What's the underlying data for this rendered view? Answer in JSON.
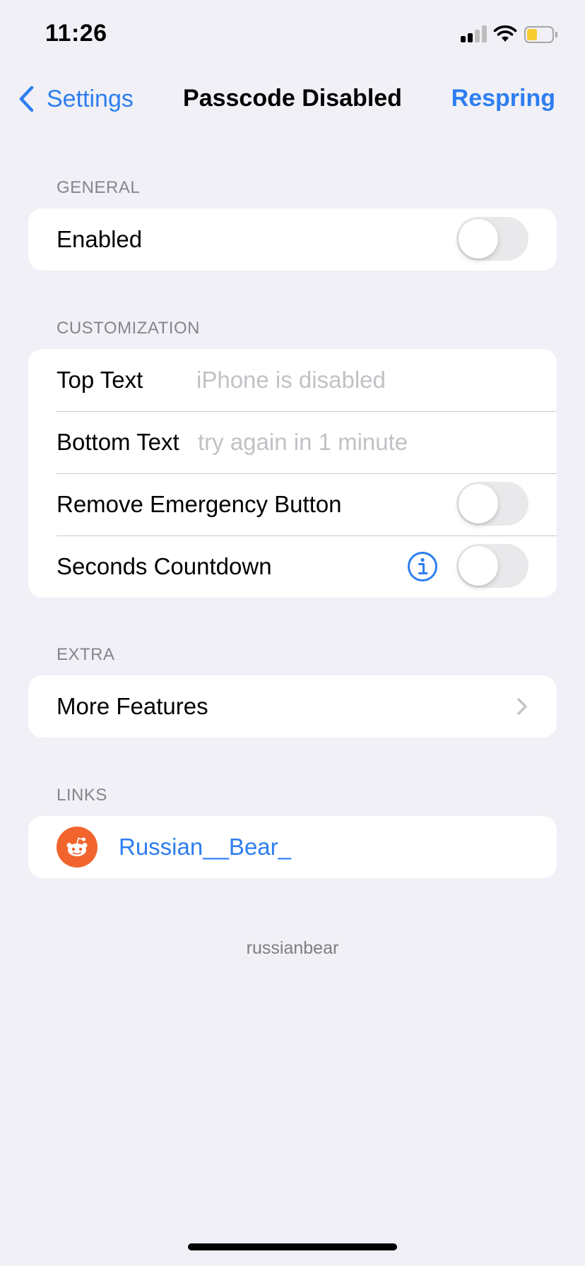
{
  "status_bar": {
    "time": "11:26",
    "signal_icon": "cellular-signal-icon",
    "wifi_icon": "wifi-icon",
    "battery_icon": "battery-icon",
    "battery_level_color": "#f5cd2f"
  },
  "nav": {
    "back_label": "Settings",
    "title": "Passcode Disabled",
    "action_label": "Respring"
  },
  "sections": {
    "general": {
      "header": "GENERAL",
      "enabled_label": "Enabled",
      "enabled_on": false
    },
    "customization": {
      "header": "CUSTOMIZATION",
      "top_text_label": "Top Text",
      "top_text_placeholder": "iPhone is disabled",
      "bottom_text_label": "Bottom Text",
      "bottom_text_placeholder": "try again in 1 minute",
      "remove_emergency_label": "Remove Emergency Button",
      "remove_emergency_on": false,
      "seconds_countdown_label": "Seconds Countdown",
      "seconds_countdown_on": false
    },
    "extra": {
      "header": "EXTRA",
      "more_features_label": "More Features"
    },
    "links": {
      "header": "LINKS",
      "reddit_label": "Russian__Bear_"
    }
  },
  "footer_text": "russianbear",
  "colors": {
    "accent": "#2d7ef0",
    "background": "#f0f0f6",
    "reddit": "#f1642d",
    "toggle_off": "#e9e9eb"
  }
}
